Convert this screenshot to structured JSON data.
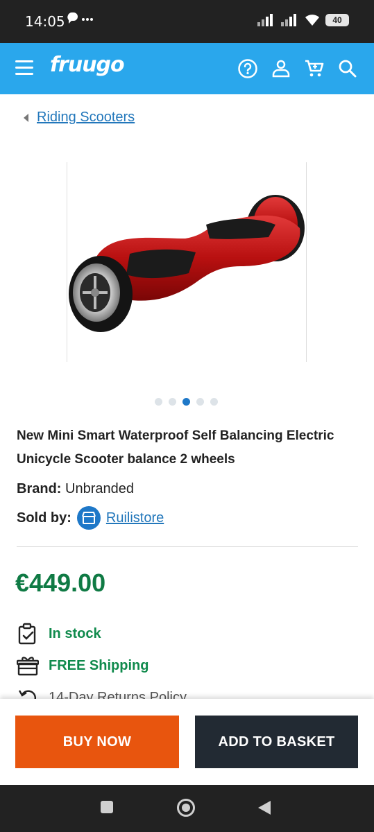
{
  "status_bar": {
    "time": "14:05",
    "battery": "40"
  },
  "header": {
    "logo": "fruugo"
  },
  "breadcrumb": {
    "label": "Riding Scooters"
  },
  "gallery": {
    "image_alt": "Red self balancing scooter",
    "dot_count": 5,
    "active_index": 2
  },
  "product": {
    "title": "New Mini Smart Waterproof Self Balancing Electric Unicycle Scooter balance 2 wheels",
    "brand_label": "Brand:",
    "brand_value": "Unbranded",
    "sold_by_label": "Sold by:",
    "seller": "Ruilistore",
    "price": "€449.00"
  },
  "features": {
    "stock": "In stock",
    "shipping": "FREE Shipping",
    "returns": "14-Day Returns Policy"
  },
  "actions": {
    "buy_now": "BUY NOW",
    "add_to_basket": "ADD TO BASKET"
  },
  "colors": {
    "header": "#2aa7ec",
    "buy": "#e8550e",
    "basket": "#222a33",
    "price": "#0f7a44",
    "link": "#2277bb"
  }
}
